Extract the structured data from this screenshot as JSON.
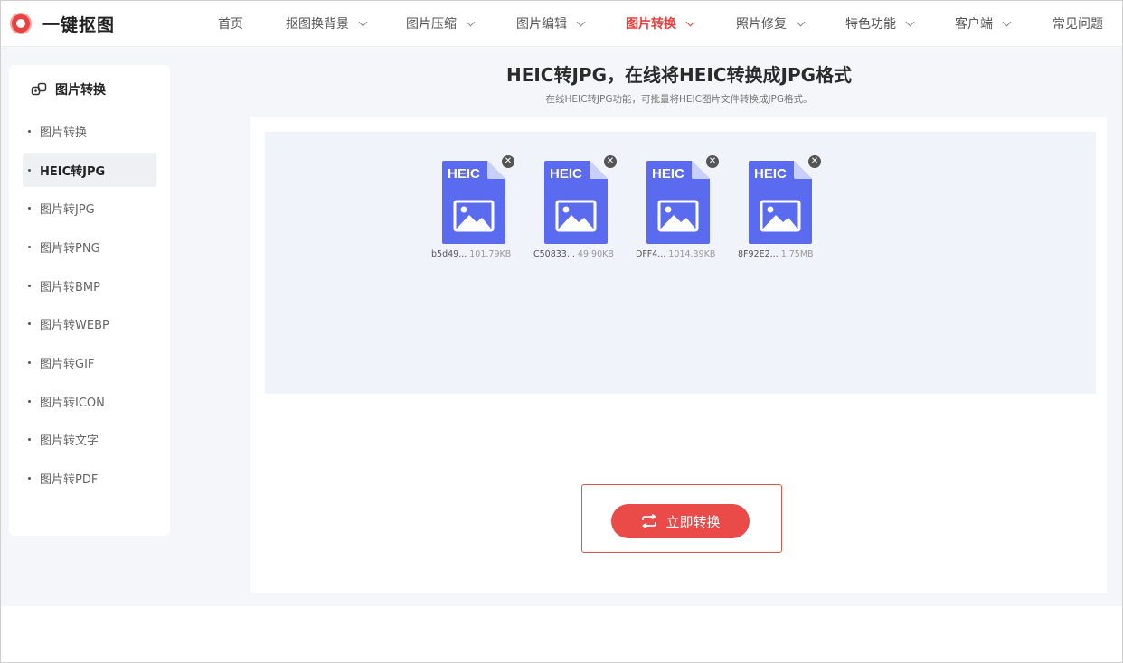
{
  "app": {
    "name": "一键抠图"
  },
  "nav": [
    {
      "label": "首页",
      "dropdown": false,
      "active": false
    },
    {
      "label": "抠图换背景",
      "dropdown": true,
      "active": false
    },
    {
      "label": "图片压缩",
      "dropdown": true,
      "active": false
    },
    {
      "label": "图片编辑",
      "dropdown": true,
      "active": false
    },
    {
      "label": "图片转换",
      "dropdown": true,
      "active": true
    },
    {
      "label": "照片修复",
      "dropdown": true,
      "active": false
    },
    {
      "label": "特色功能",
      "dropdown": true,
      "active": false
    },
    {
      "label": "客户端",
      "dropdown": true,
      "active": false
    },
    {
      "label": "常见问题",
      "dropdown": false,
      "active": false
    }
  ],
  "sidebar": {
    "heading": "图片转换",
    "items": [
      {
        "label": "图片转换",
        "active": false
      },
      {
        "label": "HEIC转JPG",
        "active": true
      },
      {
        "label": "图片转JPG",
        "active": false
      },
      {
        "label": "图片转PNG",
        "active": false
      },
      {
        "label": "图片转BMP",
        "active": false
      },
      {
        "label": "图片转WEBP",
        "active": false
      },
      {
        "label": "图片转GIF",
        "active": false
      },
      {
        "label": "图片转ICON",
        "active": false
      },
      {
        "label": "图片转文字",
        "active": false
      },
      {
        "label": "图片转PDF",
        "active": false
      }
    ]
  },
  "main": {
    "title": "HEIC转JPG，在线将HEIC转换成JPG格式",
    "subtitle": "在线HEIC转JPG功能，可批量将HEIC图片文件转换成JPG格式。",
    "files": [
      {
        "name": "b5d49...",
        "size": "101.79KB",
        "badge": "HEIC"
      },
      {
        "name": "C50833...",
        "size": "49.90KB",
        "badge": "HEIC"
      },
      {
        "name": "DFF4...",
        "size": "1014.39KB",
        "badge": "HEIC"
      },
      {
        "name": "8F92E2...",
        "size": "1.75MB",
        "badge": "HEIC"
      }
    ],
    "convert_button": "立即转换"
  },
  "colors": {
    "accent": "#ea4a48",
    "file_icon": "#5b6bf0",
    "dropzone": "#f1f3fb"
  },
  "icons": {
    "logo": "logo-ring-icon",
    "sidebar_heading": "image-convert-icon",
    "file": "heic-file-icon",
    "remove": "close-icon",
    "convert": "convert-arrows-icon"
  }
}
